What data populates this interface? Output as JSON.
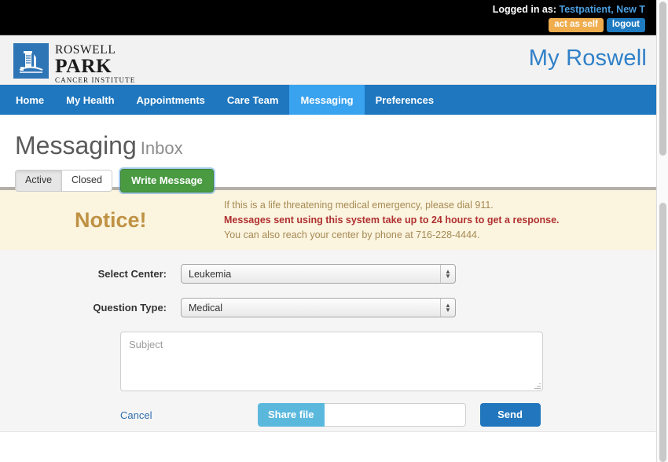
{
  "topbar": {
    "logged_in_label": "Logged in as:",
    "user_name": "Testpatient, New T",
    "act_as_self_label": "act as self",
    "logout_label": "logout"
  },
  "header": {
    "logo_line1": "ROSWELL",
    "logo_line2": "PARK",
    "logo_line3": "CANCER INSTITUTE",
    "brand": "My Roswell"
  },
  "nav": {
    "items": [
      {
        "label": "Home",
        "active": false
      },
      {
        "label": "My Health",
        "active": false
      },
      {
        "label": "Appointments",
        "active": false
      },
      {
        "label": "Care Team",
        "active": false
      },
      {
        "label": "Messaging",
        "active": true
      },
      {
        "label": "Preferences",
        "active": false
      }
    ]
  },
  "page": {
    "title": "Messaging",
    "subtitle": "Inbox",
    "filter_active": "Active",
    "filter_closed": "Closed",
    "write_message": "Write Message"
  },
  "notice": {
    "title": "Notice!",
    "line1": "If this is a life threatening medical emergency, please dial 911.",
    "line2": "Messages sent using this system take up to 24 hours to get a response.",
    "line3": "You can also reach your center by phone at 716-228-4444."
  },
  "form": {
    "center_label": "Select Center:",
    "center_value": "Leukemia",
    "question_label": "Question Type:",
    "question_value": "Medical",
    "subject_placeholder": "Subject",
    "subject_value": "",
    "cancel_label": "Cancel",
    "share_file_label": "Share file",
    "share_file_value": "",
    "send_label": "Send"
  },
  "colors": {
    "nav_blue": "#1e77bf",
    "nav_active_blue": "#3aa3ef",
    "brand_blue": "#2f80c8",
    "green": "#4a9a42",
    "orange": "#f0ad4e",
    "notice_bg": "#fbf4df",
    "notice_gold": "#bf9244",
    "notice_red": "#b03030",
    "send_blue": "#2176bd",
    "share_blue": "#5bb8dd"
  }
}
